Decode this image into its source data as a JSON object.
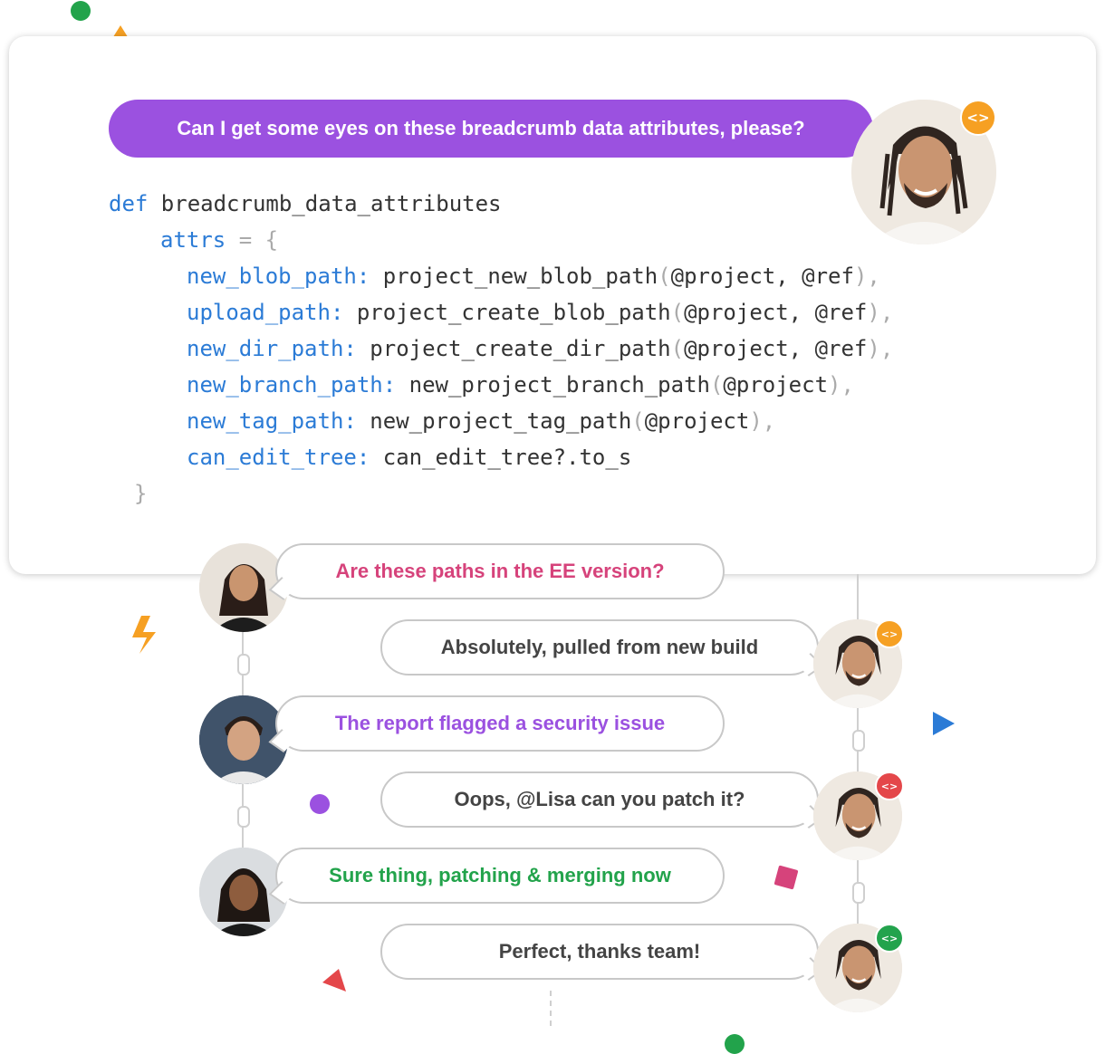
{
  "request_bubble": {
    "text": "Can I get some eyes on these breadcrumb data attributes, please?"
  },
  "code": {
    "lines": [
      {
        "keyword": "def",
        "rest": " breadcrumb_data_attributes"
      },
      {
        "key": "attrs",
        "op": " = {"
      },
      {
        "key": "new_blob_path:",
        "value": " project_new_blob_path",
        "args": "(@project, @ref),",
        "open": "(",
        "inner": "@project, @ref",
        "close": "),"
      },
      {
        "key": "upload_path:",
        "value": " project_create_blob_path",
        "open": "(",
        "inner": "@project, @ref",
        "close": "),"
      },
      {
        "key": "new_dir_path:",
        "value": " project_create_dir_path",
        "open": "(",
        "inner": "@project, @ref",
        "close": "),"
      },
      {
        "key": "new_branch_path:",
        "value": " new_project_branch_path",
        "open": "(",
        "inner": "@project",
        "close": "),"
      },
      {
        "key": "new_tag_path:",
        "value": " new_project_tag_path",
        "open": "(",
        "inner": "@project",
        "close": "),"
      },
      {
        "key": "can_edit_tree:",
        "value": " can_edit_tree?.to_s"
      },
      {
        "close_brace": "}"
      }
    ]
  },
  "messages": [
    {
      "text": "Are these paths in the EE version?",
      "side": "left",
      "color": "#d6437b"
    },
    {
      "text": "Absolutely, pulled from new build",
      "side": "right",
      "color": "#444444",
      "badge_color": "#f6a023"
    },
    {
      "text": "The report flagged a security issue",
      "side": "left",
      "color": "#9b51e0"
    },
    {
      "text": "Oops,  @Lisa can you patch it?",
      "side": "right",
      "color": "#444444",
      "badge_color": "#e4474a"
    },
    {
      "text": "Sure thing, patching & merging now",
      "side": "left",
      "color": "#22a34b"
    },
    {
      "text": "Perfect, thanks team!",
      "side": "right",
      "color": "#444444",
      "badge_color": "#23a34d"
    }
  ],
  "main_badge_color": "#f6a023",
  "badge_icon": "code-brackets-icon",
  "badge_glyph": "<>",
  "colors": {
    "purple": "#9b51e0",
    "blue": "#2b7bd6",
    "orange": "#f6a023",
    "green": "#22a34b",
    "pink": "#d6437b",
    "red": "#e4474a"
  }
}
